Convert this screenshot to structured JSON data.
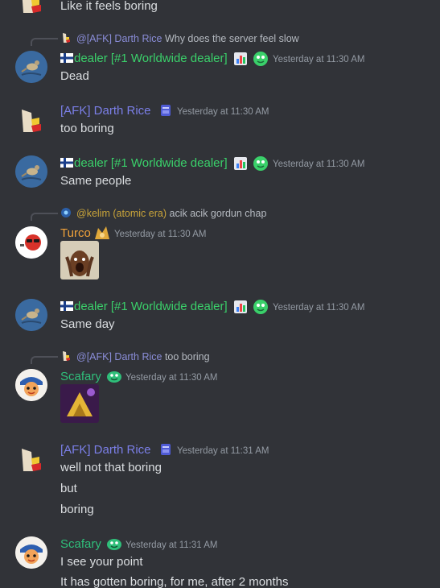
{
  "messages": {
    "top": {
      "text": "Like it feels boring"
    },
    "m1": {
      "reply_name": "@[AFK] Darth Rice",
      "reply_text": "Why does the server feel slow",
      "name": "dealer [#1 Worldwide dealer]",
      "time": "Yesterday at 11:30 AM",
      "text": "Dead"
    },
    "m2": {
      "name": "[AFK] Darth Rice",
      "time": "Yesterday at 11:30 AM",
      "text": "too boring"
    },
    "m3": {
      "name": "dealer [#1 Worldwide dealer]",
      "time": "Yesterday at 11:30 AM",
      "text": "Same people"
    },
    "m4": {
      "reply_name": "@kelim (atomic era)",
      "reply_text": "acik acik gordun chap",
      "name": "Turco",
      "time": "Yesterday at 11:30 AM"
    },
    "m5": {
      "name": "dealer [#1 Worldwide dealer]",
      "time": "Yesterday at 11:30 AM",
      "text": "Same day"
    },
    "m6": {
      "reply_name": "@[AFK] Darth Rice",
      "reply_text": "too boring",
      "name": "Scafary",
      "time": "Yesterday at 11:30 AM"
    },
    "m7": {
      "name": "[AFK] Darth Rice",
      "time": "Yesterday at 11:31 AM",
      "lines": [
        "well not that boring",
        "but",
        "boring"
      ]
    },
    "m8": {
      "name": "Scafary",
      "time": "Yesterday at 11:31 AM",
      "lines": [
        "I see your point",
        "It has gotten boring, for me, after 2 months"
      ]
    }
  },
  "colors": {
    "background": "#313338",
    "dealer": "#3ad06a",
    "darth": "#7b7fe8",
    "turco": "#f0a23a",
    "scafary": "#2fbf7a",
    "timestamp": "#949ba4",
    "text": "#dbdee1"
  },
  "icons": [
    "finland-flag-icon",
    "bar-chart-badge-icon",
    "green-creature-badge-icon",
    "blue-card-badge-icon",
    "gold-badge-icon"
  ]
}
